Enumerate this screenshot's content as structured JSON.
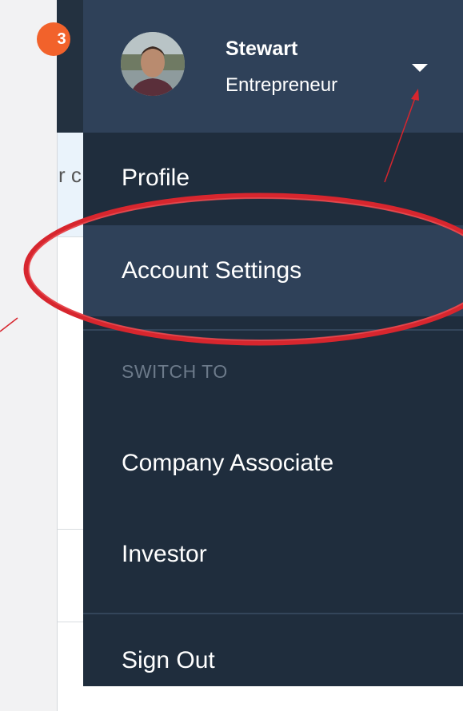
{
  "background": {
    "notification_badge": "3",
    "search_fragment": "r c"
  },
  "user": {
    "name": "Stewart",
    "role": "Entrepreneur"
  },
  "menu": {
    "profile": "Profile",
    "account_settings": "Account Settings",
    "switch_to_label": "SWITCH TO",
    "company_associate": "Company Associate",
    "investor": "Investor",
    "sign_out": "Sign Out"
  },
  "colors": {
    "header_bg": "#2f4159",
    "menu_bg": "#1f2d3d",
    "highlight": "#2f4159",
    "annotation_red": "#d7262e",
    "badge": "#f2622b"
  },
  "icons": {
    "dropdown_caret": "chevron-down-icon",
    "avatar": "avatar-photo"
  }
}
